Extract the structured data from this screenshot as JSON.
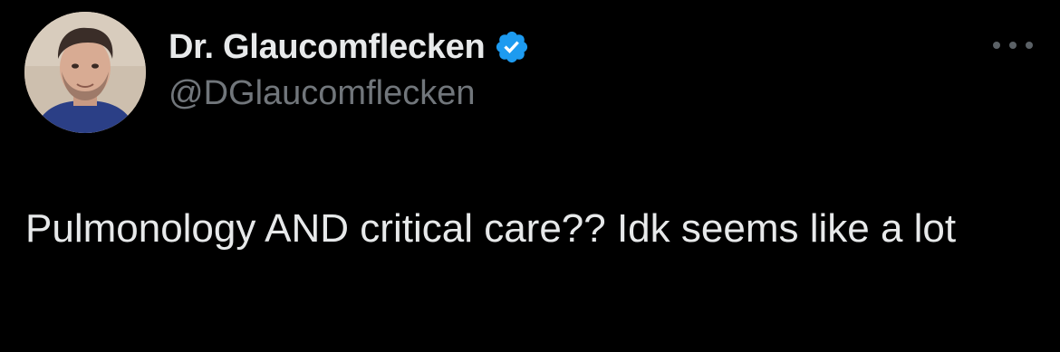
{
  "author": {
    "display_name": "Dr. Glaucomflecken",
    "handle": "@DGlaucomflecken",
    "verified": true,
    "avatar_icon": "profile-photo"
  },
  "tweet": {
    "text": "Pulmonology AND critical care?? Idk seems like a lot"
  },
  "icons": {
    "verified": "verified-badge-icon",
    "more": "more-options-icon"
  },
  "colors": {
    "background": "#000000",
    "primary_text": "#e7e9ea",
    "secondary_text": "#71767b",
    "verified_blue": "#1d9bf0"
  }
}
